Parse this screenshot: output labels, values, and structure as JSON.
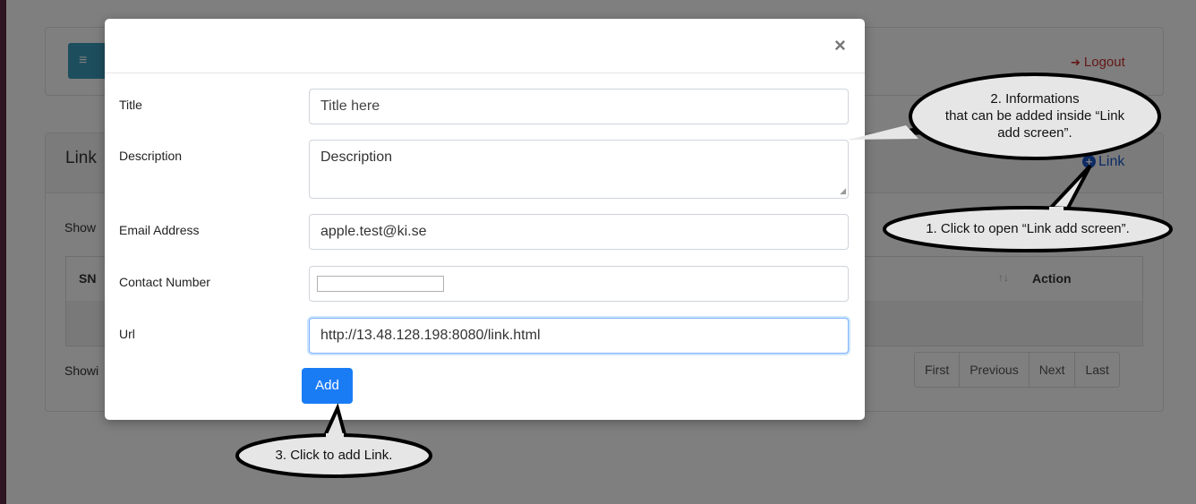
{
  "topbar": {
    "menu_glyph": "≡",
    "logout_icon": "sign-out-icon",
    "logout_label": "Logout"
  },
  "card": {
    "title": "Link",
    "add_link_label": "Link",
    "show_label": "Show",
    "showing_label": "Showi"
  },
  "table": {
    "headers": [
      "SN",
      "Action"
    ],
    "sort_glyph": "↑↓"
  },
  "pagination": [
    "First",
    "Previous",
    "Next",
    "Last"
  ],
  "modal": {
    "close_glyph": "×",
    "fields": {
      "title": {
        "label": "Title",
        "placeholder": "Title here"
      },
      "description": {
        "label": "Description",
        "placeholder": "Description"
      },
      "email": {
        "label": "Email Address",
        "value": "apple.test@ki.se"
      },
      "contact": {
        "label": "Contact Number",
        "value": ""
      },
      "url": {
        "label": "Url",
        "value": "http://13.48.128.198:8080/link.html"
      }
    },
    "add_button": "Add"
  },
  "callouts": {
    "c1": "1. Click to open “Link add screen”.",
    "c2_line1": "2. Informations",
    "c2_line2": "that can be added inside “Link",
    "c2_line3": "add screen”.",
    "c3": "3. Click to add Link."
  },
  "colors": {
    "accent": "#1a7cf5",
    "logout": "#c9302c",
    "link": "#1a57c8",
    "menu_button": "#3a9cbc"
  }
}
